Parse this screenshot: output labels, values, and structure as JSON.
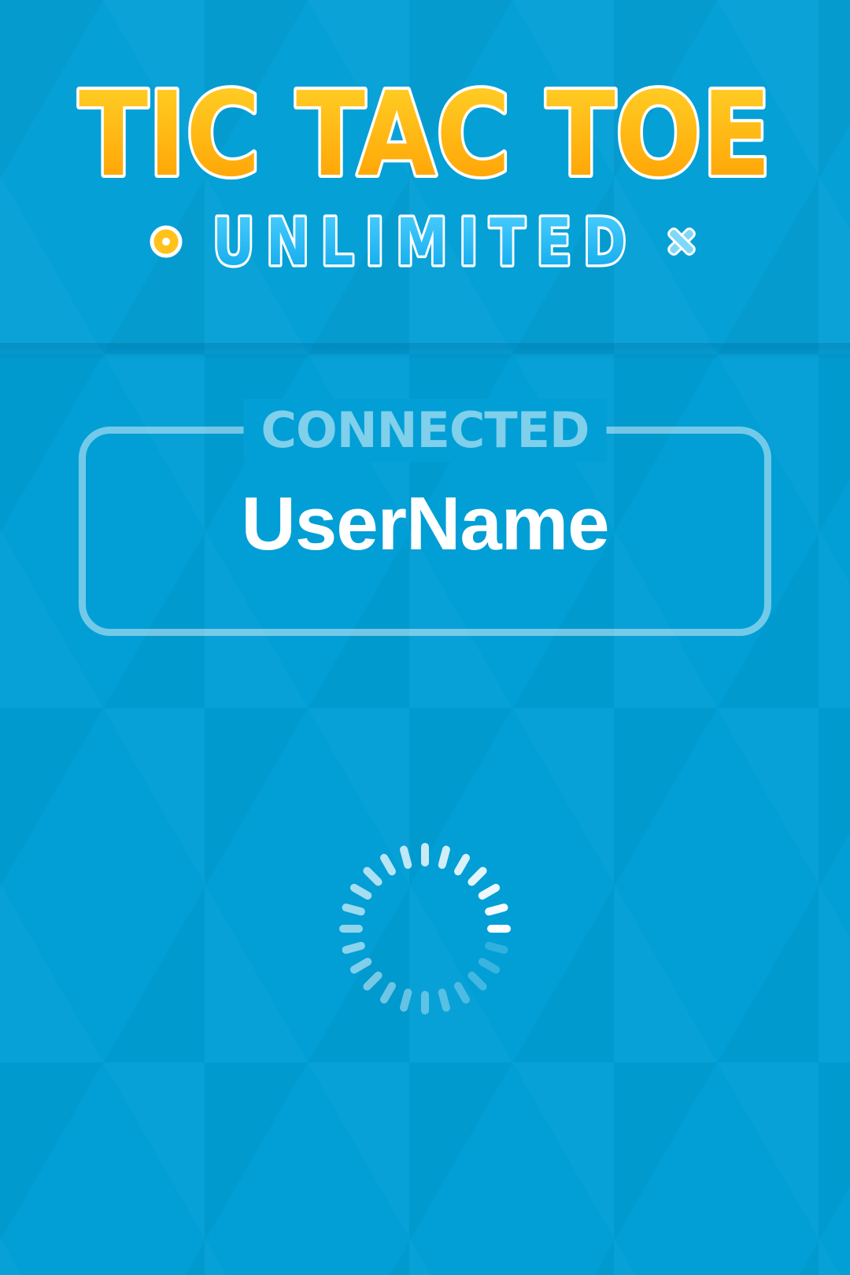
{
  "logo": {
    "title": "TIC TAC TOE",
    "subtitle": "UNLIMITED",
    "left_mark": "circle-icon",
    "right_mark": "cross-icon"
  },
  "status_panel": {
    "caption": "CONNECTED",
    "username": "UserName"
  },
  "loading": {
    "icon": "loading-spinner-icon"
  },
  "colors": {
    "background": "#019fd6",
    "title_gold_top": "#ffd42a",
    "title_gold_bottom": "#ff9d00",
    "subtitle_blue_top": "#4fd0ff",
    "subtitle_blue_bottom": "#0aa7ea",
    "text_white": "#ffffff"
  }
}
